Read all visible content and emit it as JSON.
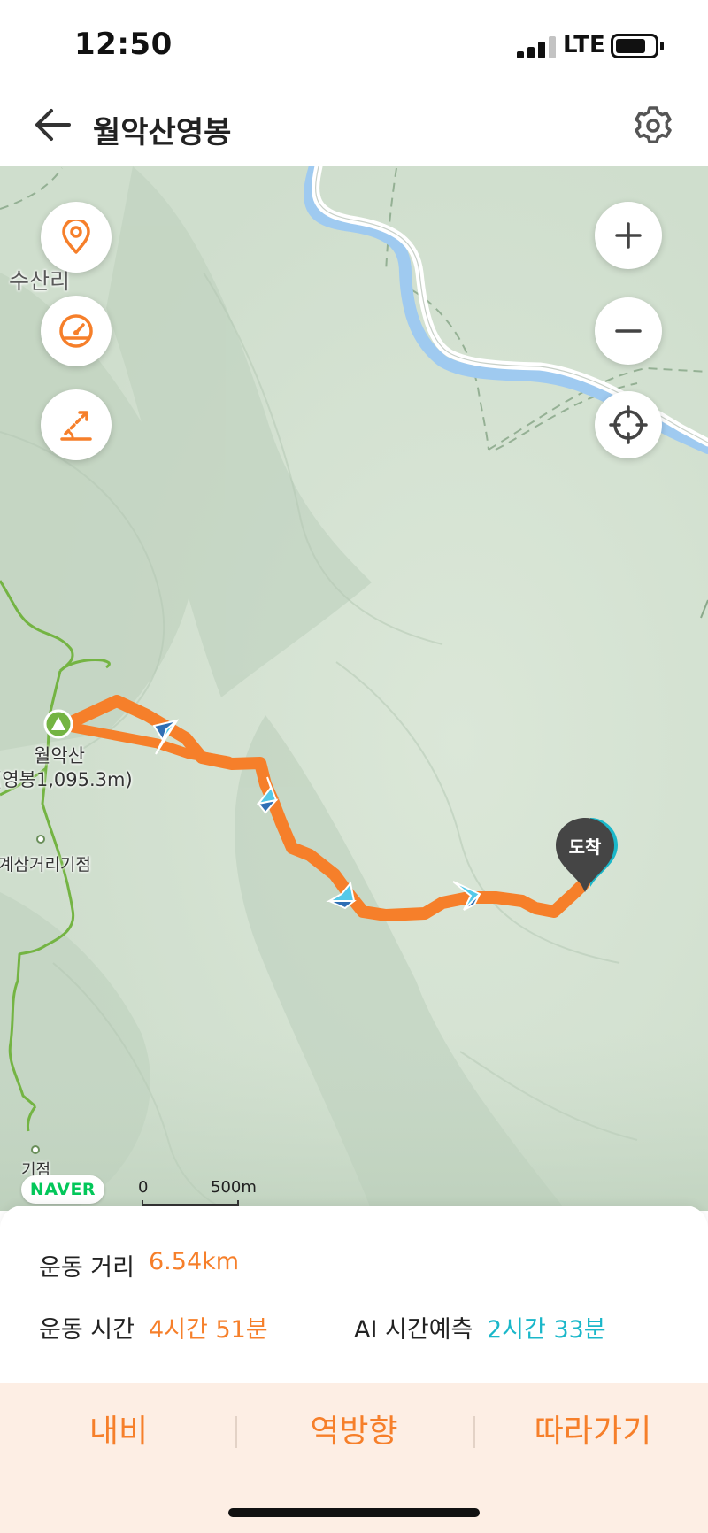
{
  "status_bar": {
    "time": "12:50",
    "network": "LTE",
    "signal_icon": "signal-bars-icon",
    "battery_icon": "battery-icon",
    "battery_level": 0.75
  },
  "header": {
    "back_icon": "arrow-left-icon",
    "title": "월악산영봉",
    "settings_icon": "gear-icon"
  },
  "map": {
    "labels": {
      "susanri": "수산리",
      "peak_name": "월악산",
      "peak_detail": "(영봉1,095.3m)",
      "junction": "계삼거리기점",
      "start": "기점"
    },
    "arrival_label": "도착",
    "provider": "NAVER",
    "scale": {
      "zero": "0",
      "distance": "500m"
    },
    "controls_left": [
      {
        "name": "location-pin-icon"
      },
      {
        "name": "speedometer-icon"
      },
      {
        "name": "elevation-graph-icon"
      }
    ],
    "controls_right": [
      {
        "name": "zoom-in-icon"
      },
      {
        "name": "zoom-out-icon"
      },
      {
        "name": "current-location-icon"
      }
    ],
    "colors": {
      "route": "#f67f2a",
      "trail": "#74b443",
      "river": "#9fcaf0",
      "road": "#ffffff",
      "terrain": "#cddccd"
    }
  },
  "stats": {
    "distance_label": "운동 거리",
    "distance_value": "6.54km",
    "time_label": "운동 시간",
    "time_value": "4시간 51분",
    "ai_label": "AI 시간예측",
    "ai_value": "2시간 33분"
  },
  "actions": {
    "navi": "내비",
    "reverse": "역방향",
    "follow": "따라가기"
  },
  "colors": {
    "accent": "#f67f2a",
    "ai_accent": "#1ab7c9",
    "action_bar_bg": "#fdeee4"
  }
}
